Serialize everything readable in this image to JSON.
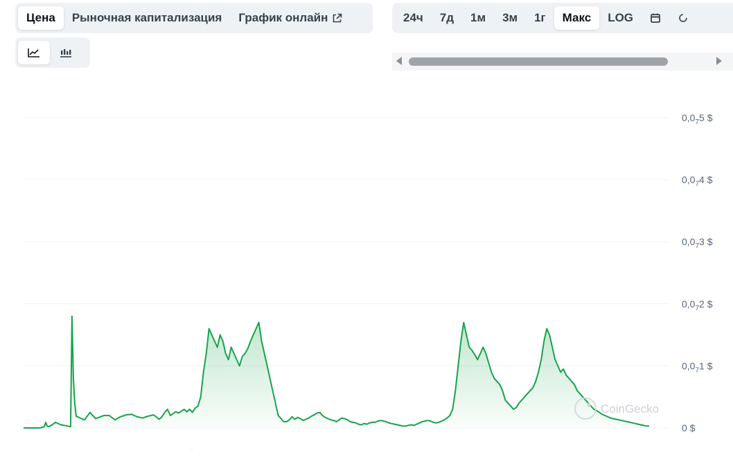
{
  "tabs_left": [
    {
      "label": "Цена",
      "active": true
    },
    {
      "label": "Рыночная капитализация",
      "active": false
    },
    {
      "label": "График онлайн",
      "active": false,
      "external": true
    }
  ],
  "tabs_right": [
    {
      "label": "24ч",
      "active": false
    },
    {
      "label": "7д",
      "active": false
    },
    {
      "label": "1м",
      "active": false
    },
    {
      "label": "3м",
      "active": false
    },
    {
      "label": "1г",
      "active": false
    },
    {
      "label": "Макс",
      "active": true
    },
    {
      "label": "LOG",
      "active": false
    }
  ],
  "icons": {
    "calendar": "calendar-icon",
    "line_chart": "line-chart-icon",
    "candlestick_chart": "candlestick-chart-icon",
    "external_link": "external-link-icon"
  },
  "watermark": "CoinGecko",
  "colors": {
    "line": "#16a34a",
    "fill": "#16a34a",
    "grid": "#eff2f5",
    "tick": "#58667e"
  },
  "chart_data": {
    "type": "area",
    "y_ticks": [
      {
        "value": 5e-08,
        "base": "0,0",
        "sub": "7",
        "tail": "5 $"
      },
      {
        "value": 4e-08,
        "base": "0,0",
        "sub": "7",
        "tail": "4 $"
      },
      {
        "value": 3e-08,
        "base": "0,0",
        "sub": "7",
        "tail": "3 $"
      },
      {
        "value": 2e-08,
        "base": "0,0",
        "sub": "7",
        "tail": "2 $"
      },
      {
        "value": 1e-08,
        "base": "0,0",
        "sub": "7",
        "tail": "1 $"
      },
      {
        "value": 0,
        "base": "0 $",
        "sub": "",
        "tail": ""
      }
    ],
    "ylim": [
      0,
      5e-08
    ],
    "x_index": [
      0,
      6,
      12,
      15,
      16,
      17,
      18,
      20,
      23,
      27,
      32,
      34,
      35,
      36,
      37,
      38,
      40,
      44,
      48,
      52,
      58,
      62,
      66,
      70,
      74,
      78,
      82,
      86,
      90,
      94,
      98,
      100,
      102,
      104,
      106,
      108,
      110,
      112,
      114,
      116,
      118,
      120,
      122,
      124,
      126,
      128,
      130,
      132,
      134,
      136,
      138,
      140,
      142,
      144,
      146,
      148,
      150,
      152,
      154,
      156,
      158,
      160,
      162,
      164,
      166,
      168,
      170,
      172,
      174,
      176,
      178,
      180,
      182,
      184,
      186,
      188,
      190,
      192,
      194,
      196,
      198,
      200,
      202,
      204,
      206,
      208,
      210,
      212,
      214,
      216,
      218,
      220,
      222,
      224,
      226,
      228,
      230,
      232,
      234,
      236,
      238,
      240,
      242,
      244,
      246,
      248,
      250,
      252,
      254,
      256,
      258,
      260,
      262,
      264,
      266,
      268,
      270,
      272,
      274,
      276,
      278,
      280,
      282,
      284,
      286,
      288,
      290,
      292,
      294,
      296,
      298,
      300,
      302,
      304,
      306,
      308,
      310,
      312,
      314,
      316,
      318,
      320,
      322,
      324,
      326,
      328,
      330,
      332,
      334,
      336,
      338,
      340,
      342,
      344,
      346,
      348,
      350,
      352,
      354,
      356,
      358,
      360,
      362,
      364,
      366,
      368,
      370,
      372,
      374,
      376,
      378,
      380,
      382,
      384,
      386,
      388,
      390,
      392,
      394,
      396,
      398,
      400,
      402,
      404,
      406,
      408,
      410,
      412,
      414,
      416,
      418,
      420,
      422,
      424,
      426,
      428,
      430,
      432,
      434,
      436,
      438,
      440,
      442,
      444,
      446,
      448,
      450,
      452,
      454,
      456,
      458,
      460,
      462,
      464,
      466
    ],
    "values": [
      0,
      0,
      0,
      2e-10,
      9e-10,
      3e-10,
      2e-10,
      4e-10,
      9e-10,
      5e-10,
      3e-10,
      2e-10,
      1.8e-08,
      8e-09,
      4e-09,
      1.9e-09,
      1.7e-09,
      1.3e-09,
      2.5e-09,
      1.5e-09,
      2e-09,
      2e-09,
      1.3e-09,
      1.8e-09,
      2.1e-09,
      2.2e-09,
      1.8e-09,
      1.6e-09,
      1.9e-09,
      2.1e-09,
      1.4e-09,
      1.8e-09,
      2.5e-09,
      3e-09,
      2e-09,
      2.3e-09,
      2.6e-09,
      2.4e-09,
      2.7e-09,
      3e-09,
      2.6e-09,
      3e-09,
      2.5e-09,
      3.2e-09,
      3.5e-09,
      5e-09,
      9e-09,
      1.2e-08,
      1.6e-08,
      1.5e-08,
      1.4e-08,
      1.3e-08,
      1.5e-08,
      1.4e-08,
      1.2e-08,
      1.1e-08,
      1.3e-08,
      1.2e-08,
      1.1e-08,
      1e-08,
      1.15e-08,
      1.2e-08,
      1.28e-08,
      1.4e-08,
      1.5e-08,
      1.6e-08,
      1.7e-08,
      1.4e-08,
      1.2e-08,
      1e-08,
      8e-09,
      6e-09,
      4e-09,
      2e-09,
      1.5e-09,
      1e-09,
      1e-09,
      1.3e-09,
      1.8e-09,
      1.4e-09,
      1.7e-09,
      1.5e-09,
      1.2e-09,
      1.4e-09,
      1.6e-09,
      1.9e-09,
      2.1e-09,
      2.4e-09,
      2.5e-09,
      2e-09,
      1.7e-09,
      1.5e-09,
      1.3e-09,
      1.2e-09,
      1e-09,
      1.3e-09,
      1.6e-09,
      1.5e-09,
      1.3e-09,
      1e-09,
      9e-10,
      8e-10,
      6e-10,
      5e-10,
      7e-10,
      6e-10,
      8e-10,
      9e-10,
      9e-10,
      1.1e-09,
      1.2e-09,
      1.1e-09,
      1e-09,
      8e-10,
      7e-10,
      6e-10,
      5e-10,
      4e-10,
      3e-10,
      3e-10,
      4e-10,
      5e-10,
      4e-10,
      6e-10,
      8e-10,
      1e-09,
      1.1e-09,
      1.2e-09,
      1.1e-09,
      9e-10,
      8e-10,
      9e-10,
      1.1e-09,
      1.3e-09,
      1.6e-09,
      2e-09,
      3e-09,
      6e-09,
      1e-08,
      1.4e-08,
      1.7e-08,
      1.5e-08,
      1.3e-08,
      1.25e-08,
      1.18e-08,
      1.1e-08,
      1.2e-08,
      1.3e-08,
      1.2e-08,
      1.05e-08,
      9e-09,
      8e-09,
      7.5e-09,
      7e-09,
      6e-09,
      4.5e-09,
      4e-09,
      3.5e-09,
      3e-09,
      3.3e-09,
      4e-09,
      4.5e-09,
      5e-09,
      5.5e-09,
      6e-09,
      6.5e-09,
      7.5e-09,
      9e-09,
      1.1e-08,
      1.4e-08,
      1.6e-08,
      1.5e-08,
      1.3e-08,
      1.1e-08,
      1e-08,
      9e-09,
      9.5e-09,
      8.5e-09,
      8e-09,
      7.5e-09,
      7e-09,
      6e-09,
      5.5e-09,
      5e-09,
      4.5e-09,
      4e-09,
      3.5e-09,
      3e-09,
      2.8e-09,
      2.5e-09,
      2.2e-09,
      2e-09,
      1.8e-09,
      1.6e-09,
      1.5e-09,
      1.4e-09,
      1.3e-09,
      1.2e-09,
      1.1e-09,
      1e-09,
      9e-10,
      8e-10,
      7e-10,
      6e-10,
      5e-10,
      4e-10,
      3e-10,
      3e-10
    ]
  }
}
